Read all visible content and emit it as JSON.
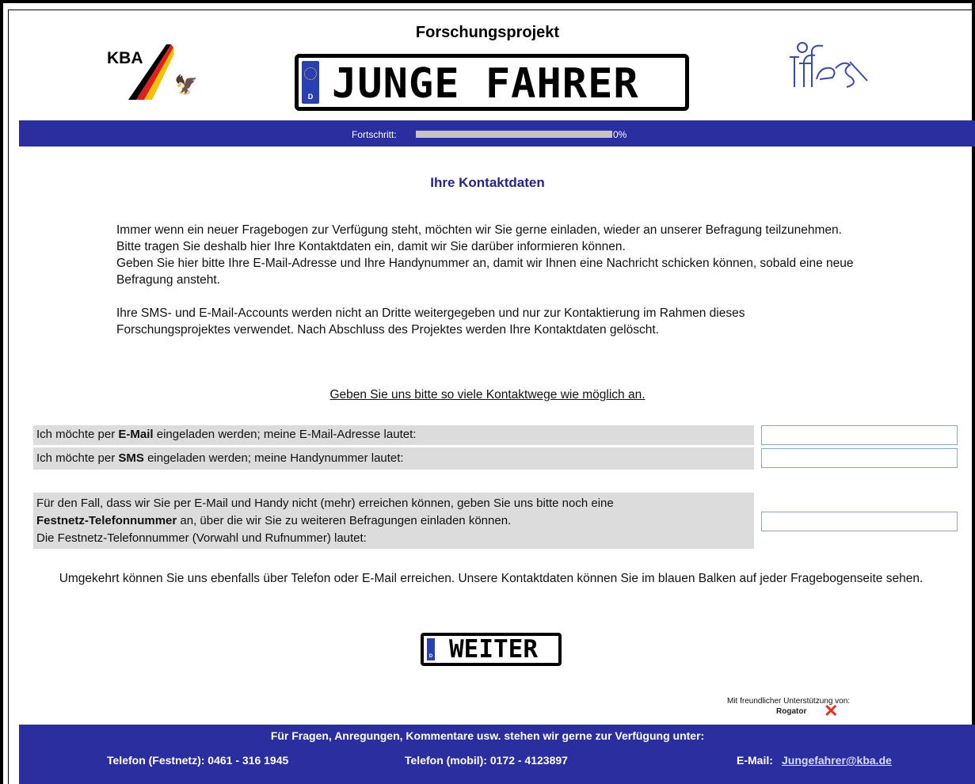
{
  "header": {
    "project_title": "Forschungsprojekt",
    "kba_logo_text": "KBA",
    "plate_country": "D",
    "plate_text": "JUNGE FAHRER",
    "ifes_logo_icon": "ifes-logo-icon"
  },
  "progress": {
    "label": "Fortschritt:",
    "value_text": "0%",
    "value_fraction": 0
  },
  "main": {
    "heading": "Ihre Kontaktdaten",
    "intro_p1": "Immer wenn ein neuer Fragebogen zur Verfügung steht, möchten wir Sie gerne einladen, wieder an unserer Befragung teilzunehmen. Bitte tragen Sie deshalb hier Ihre Kontaktdaten ein, damit wir Sie darüber informieren können.",
    "intro_p2": "Geben Sie hier bitte Ihre E-Mail-Adresse und Ihre Handynummer an, damit wir Ihnen eine Nachricht schicken können, sobald eine neue Befragung ansteht.",
    "intro_p3": "Ihre SMS- und E-Mail-Accounts werden nicht an Dritte weitergegeben und nur zur Kontaktierung im Rahmen dieses Forschungsprojektes verwendet. Nach Abschluss des Projektes werden Ihre Kontaktdaten gelöscht.",
    "cta": "Geben Sie uns bitte so viele Kontaktwege wie möglich an.",
    "email_row": {
      "pre": "Ich möchte per ",
      "bold": "E-Mail",
      "post": " eingeladen werden; meine E-Mail-Adresse lautet:",
      "value": ""
    },
    "sms_row": {
      "pre": "Ich möchte per ",
      "bold": "SMS",
      "post": " eingeladen werden; meine Handynummer lautet:",
      "value": ""
    },
    "landline_row": {
      "line1": "Für den Fall, dass wir Sie per E-Mail und Handy nicht (mehr) erreichen können, geben Sie uns bitte noch eine",
      "bold": "Festnetz-Telefonnummer",
      "line2_post": " an, über die wir Sie zu weiteren Befragungen einladen können.",
      "line3": "Die Festnetz-Telefonnummer (Vorwahl und Rufnummer) lautet:",
      "value": ""
    },
    "reverse_note": "Umgekehrt können Sie uns ebenfalls über Telefon oder E-Mail erreichen. Unsere Kontaktdaten können Sie im blauen Balken auf jeder Fragebogenseite sehen.",
    "next_button": {
      "country": "D",
      "label": "WEITER"
    }
  },
  "support": {
    "text": "Mit freundlicher Unterstützung von:",
    "brand": "Rogator",
    "brand_icon": "rogator-x-icon"
  },
  "footer": {
    "line1": "Für Fragen, Anregungen, Kommentare usw. stehen wir gerne zur Verfügung unter:",
    "phone_landline": "Telefon (Festnetz): 0461 - 316 1945",
    "phone_mobile": "Telefon (mobil): 0172 - 4123897",
    "email_label": "E-Mail:",
    "email": "Jungefahrer@kba.de"
  },
  "colors": {
    "bar_blue": "#2a2e9e",
    "heading_blue": "#24248a",
    "row_gray": "#dcdcdc",
    "rogator_red": "#e8301c"
  }
}
